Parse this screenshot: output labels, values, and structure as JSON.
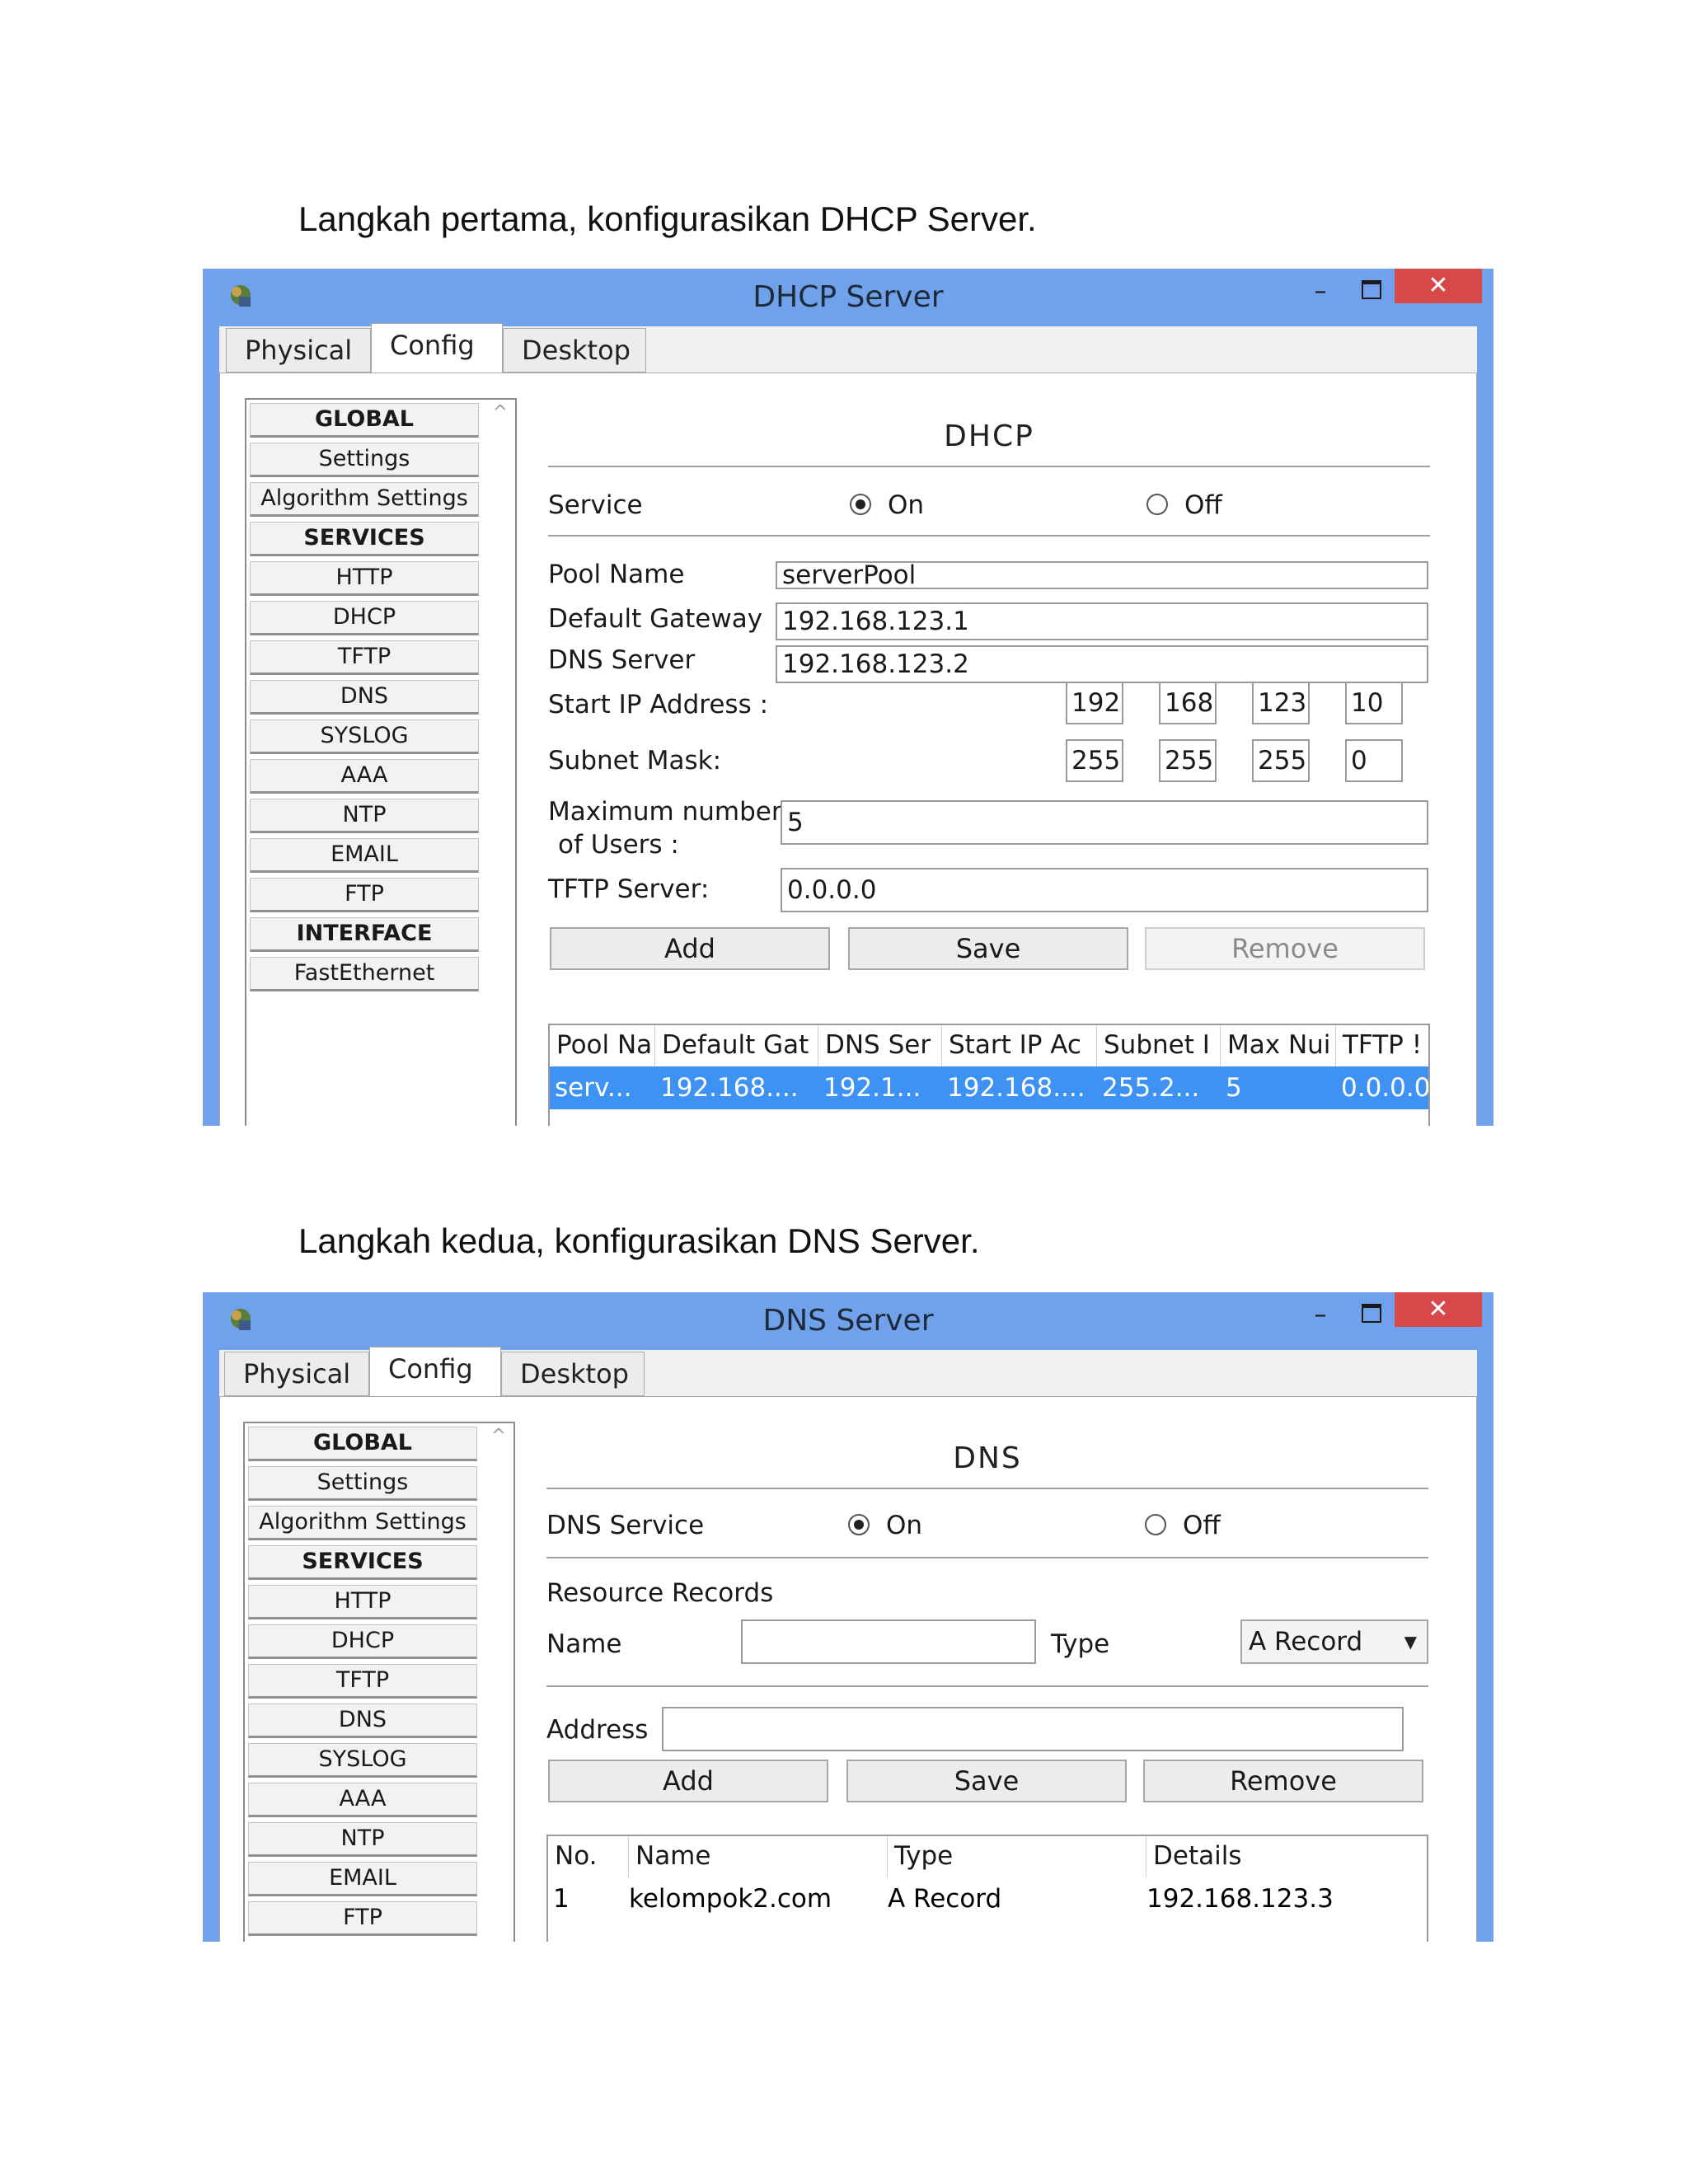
{
  "doc": {
    "caption1": "Langkah pertama, konfigurasikan DHCP Server.",
    "caption2": "Langkah kedua, konfigurasikan DNS Server."
  },
  "colors": {
    "titlebar": "#6fa2ea",
    "close": "#d7484a",
    "selection": "#3d92f3"
  },
  "dhcp": {
    "window_title": "DHCP Server",
    "tabs": [
      "Physical",
      "Config",
      "Desktop"
    ],
    "active_tab": "Config",
    "sidebar": [
      "GLOBAL",
      "Settings",
      "Algorithm Settings",
      "SERVICES",
      "HTTP",
      "DHCP",
      "TFTP",
      "DNS",
      "SYSLOG",
      "AAA",
      "NTP",
      "EMAIL",
      "FTP",
      "INTERFACE",
      "FastEthernet"
    ],
    "panel_title": "DHCP",
    "service_label": "Service",
    "on_label": "On",
    "off_label": "Off",
    "service_state": "On",
    "pool_name_label": "Pool Name",
    "pool_name": "serverPool",
    "gateway_label": "Default Gateway",
    "gateway": "192.168.123.1",
    "dns_label": "DNS Server",
    "dns": "192.168.123.2",
    "start_ip_label": "Start IP Address :",
    "start_ip": [
      "192",
      "168",
      "123",
      "10"
    ],
    "subnet_label": "Subnet Mask:",
    "subnet": [
      "255",
      "255",
      "255",
      "0"
    ],
    "max_users_label_1": "Maximum number",
    "max_users_label_2": "of Users :",
    "max_users": "5",
    "tftp_label": "TFTP Server:",
    "tftp": "0.0.0.0",
    "add": "Add",
    "save": "Save",
    "remove": "Remove",
    "table_headers": [
      "Pool Na",
      "Default Gat",
      "DNS Ser",
      "Start IP Ac",
      "Subnet I",
      "Max Nui",
      "TFTP !"
    ],
    "table_row": [
      "serv...",
      "192.168....",
      "192.1...",
      "192.168....",
      "255.2...",
      "5",
      "0.0.0.0"
    ]
  },
  "dnsw": {
    "window_title": "DNS Server",
    "tabs": [
      "Physical",
      "Config",
      "Desktop"
    ],
    "active_tab": "Config",
    "sidebar": [
      "GLOBAL",
      "Settings",
      "Algorithm Settings",
      "SERVICES",
      "HTTP",
      "DHCP",
      "TFTP",
      "DNS",
      "SYSLOG",
      "AAA",
      "NTP",
      "EMAIL",
      "FTP"
    ],
    "panel_title": "DNS",
    "service_label": "DNS Service",
    "on_label": "On",
    "off_label": "Off",
    "service_state": "On",
    "rr_label": "Resource Records",
    "name_label": "Name",
    "name_value": "",
    "type_label": "Type",
    "type_value": "A Record",
    "address_label": "Address",
    "address_value": "",
    "add": "Add",
    "save": "Save",
    "remove": "Remove",
    "table_headers": [
      "No.",
      "Name",
      "Type",
      "Details"
    ],
    "table_row": [
      "1",
      "kelompok2.com",
      "A Record",
      "192.168.123.3"
    ]
  }
}
